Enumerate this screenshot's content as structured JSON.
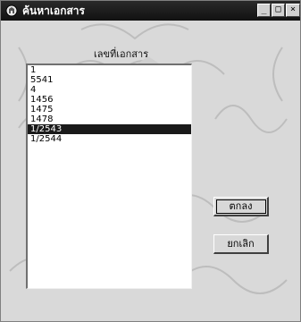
{
  "window": {
    "title": "ค้นหาเอกสาร",
    "buttons": {
      "minimize": "_",
      "maximize": "□",
      "close": "×"
    }
  },
  "form": {
    "label": "เลขที่เอกสาร",
    "list_items": [
      "1",
      "5541",
      "4",
      "1456",
      "1475",
      "1478",
      "1/2543",
      "1/2544"
    ],
    "selected_item": "1/2543",
    "ok_label": "ตกลง",
    "cancel_label": "ยกเลิก"
  },
  "icons": {
    "title_icon": "app-icon"
  },
  "colors": {
    "titlebar": "#1a1a1a",
    "selection": "#1a1a1a",
    "background": "#d9d9d9"
  }
}
